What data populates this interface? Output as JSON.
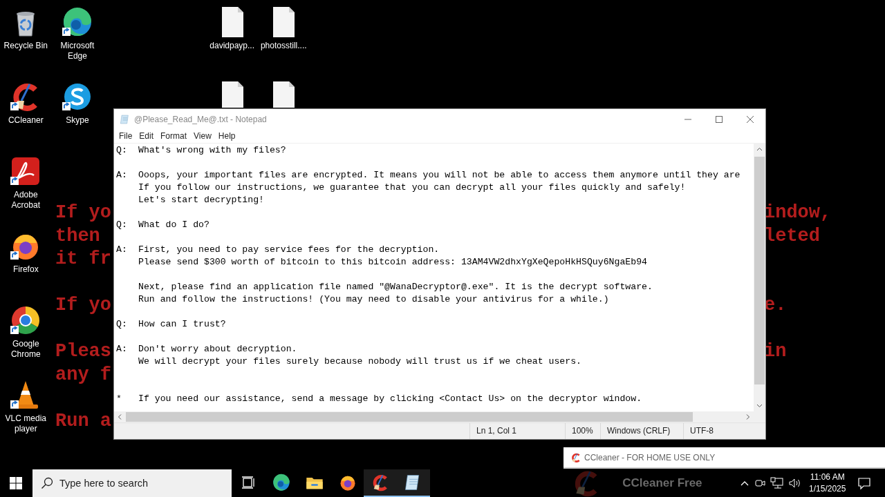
{
  "wallpaper": {
    "paragraphs": [
      [
        {
          "left": "If yo",
          "right": "indow,"
        },
        {
          "left": "then",
          "right": "leted"
        },
        {
          "left": "it fr"
        }
      ],
      [
        {
          "left": "If yo",
          "right": "e."
        }
      ],
      [
        {
          "left": "Pleas",
          "right": "in"
        },
        {
          "left": "any f"
        }
      ],
      [
        {
          "left": "Run a"
        }
      ]
    ]
  },
  "desktop": {
    "columns": [
      {
        "icons": [
          {
            "kind": "recycle-bin",
            "label": "Recycle Bin",
            "shortcut": false
          },
          {
            "kind": "ccleaner",
            "label": "CCleaner",
            "shortcut": true
          },
          {
            "kind": "acrobat",
            "label": "Adobe Acrobat",
            "shortcut": true
          },
          {
            "kind": "firefox",
            "label": "Firefox",
            "shortcut": true
          },
          {
            "kind": "chrome",
            "label": "Google Chrome",
            "shortcut": true
          },
          {
            "kind": "vlc",
            "label": "VLC media player",
            "shortcut": true
          }
        ]
      },
      {
        "icons": [
          {
            "kind": "edge",
            "label": "Microsoft Edge",
            "shortcut": true
          },
          {
            "kind": "skype",
            "label": "Skype",
            "shortcut": true
          }
        ]
      },
      {
        "icons": [
          {
            "kind": "file",
            "label": "davidpayp...",
            "shortcut": false
          },
          {
            "kind": "file",
            "shortcut": false
          }
        ]
      },
      {
        "icons": [
          {
            "kind": "file",
            "label": "photosstill....",
            "shortcut": false
          },
          {
            "kind": "file",
            "shortcut": false
          }
        ]
      }
    ]
  },
  "notepad": {
    "title": "@Please_Read_Me@.txt - Notepad",
    "menu": [
      "File",
      "Edit",
      "Format",
      "View",
      "Help"
    ],
    "blocks": [
      {
        "kind": "question",
        "marker": "Q:",
        "paragraphs": [
          [
            "What's wrong with my files?"
          ]
        ]
      },
      {
        "kind": "answer",
        "marker": "A:",
        "paragraphs": [
          [
            "Ooops, your important files are encrypted. It means you will not be able to access them anymore until they are",
            "If you follow our instructions, we guarantee that you can decrypt all your files quickly and safely!",
            "Let's start decrypting!"
          ]
        ]
      },
      {
        "kind": "question",
        "marker": "Q:",
        "paragraphs": [
          [
            "What do I do?"
          ]
        ]
      },
      {
        "kind": "answer",
        "marker": "A:",
        "paragraphs": [
          [
            "First, you need to pay service fees for the decryption.",
            "Please send $300 worth of bitcoin to this bitcoin address: 13AM4VW2dhxYgXeQepoHkHSQuy6NgaEb94"
          ],
          [
            "Next, please find an application file named \"@WanaDecryptor@.exe\". It is the decrypt software.",
            "Run and follow the instructions! (You may need to disable your antivirus for a while.)"
          ]
        ]
      },
      {
        "kind": "question",
        "marker": "Q:",
        "paragraphs": [
          [
            "How can I trust?"
          ]
        ]
      },
      {
        "kind": "answer",
        "marker": "A:",
        "paragraphs": [
          [
            "Don't worry about decryption.",
            "We will decrypt your files surely because nobody will trust us if we cheat users."
          ]
        ]
      },
      {
        "kind": "note",
        "marker": "*",
        "paragraphs": [
          [
            "If you need our assistance, send a message by clicking <Contact Us> on the decryptor window."
          ]
        ]
      }
    ],
    "status_bar": [
      "Ln 1, Col 1",
      "100%",
      "Windows (CRLF)",
      "UTF-8"
    ]
  },
  "notification": {
    "title": "CCleaner - FOR HOME USE ONLY",
    "preview_title": "CCleaner Free"
  },
  "taskbar": {
    "search": {
      "placeholder": "Type here to search"
    },
    "apps": [
      {
        "kind": "edge",
        "running": false
      },
      {
        "kind": "explorer",
        "running": false
      },
      {
        "kind": "firefox",
        "running": false
      },
      {
        "kind": "ccleaner",
        "running": true
      },
      {
        "kind": "notepad",
        "running": true
      }
    ],
    "clock": {
      "time": "11:06 AM",
      "date": "1/15/2025"
    }
  }
}
